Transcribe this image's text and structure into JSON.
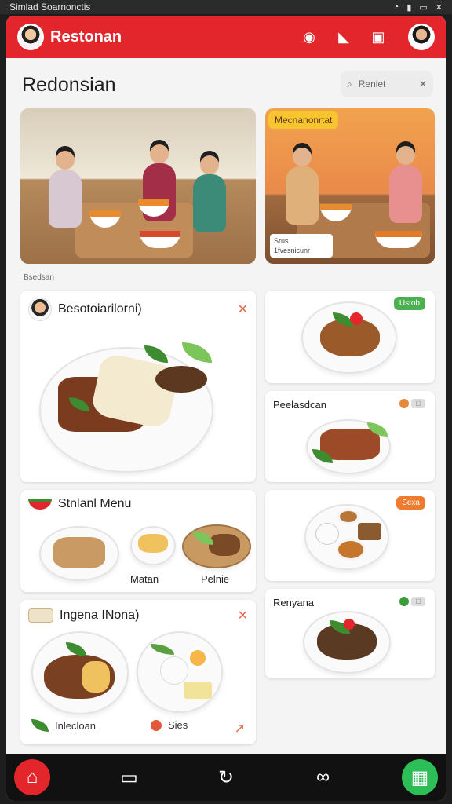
{
  "status_bar": {
    "text": "Simlad Soarnonctis",
    "icons": [
      "wifi-icon",
      "signal-icon",
      "battery-icon",
      "close-icon"
    ]
  },
  "app": {
    "title": "Restonan",
    "actions": [
      "record-icon",
      "send-icon",
      "flag-icon"
    ],
    "accent": "#e3262b"
  },
  "page": {
    "title": "Redonsian",
    "search_placeholder": "Reniet"
  },
  "heroes": [
    {
      "badge": "",
      "rating_line1": "",
      "rating_line2": ""
    },
    {
      "badge": "Mecnanonrtat",
      "rating_line1": "Srus",
      "rating_line2": "1fvesnicunr"
    }
  ],
  "section_label": "Bsedsan",
  "cards_left": [
    {
      "title": "Besotoiarilorni)"
    },
    {
      "title": "Stnlanl Menu",
      "labels": [
        "Matan",
        "Pelnie"
      ]
    },
    {
      "title": "Ingena INona)",
      "footer_left": "Inlecloan",
      "footer_right": "Sies"
    }
  ],
  "cards_right": [
    {
      "tag": "Ustob",
      "tag_color": "#4caf50"
    },
    {
      "title": "Peelasdcan"
    },
    {
      "tag": "Sexa",
      "tag_color": "#f07b2e"
    },
    {
      "title": "Renyana"
    }
  ],
  "bottom_nav": [
    "home-icon",
    "card-icon",
    "refresh-icon",
    "link-icon",
    "grid-icon"
  ]
}
